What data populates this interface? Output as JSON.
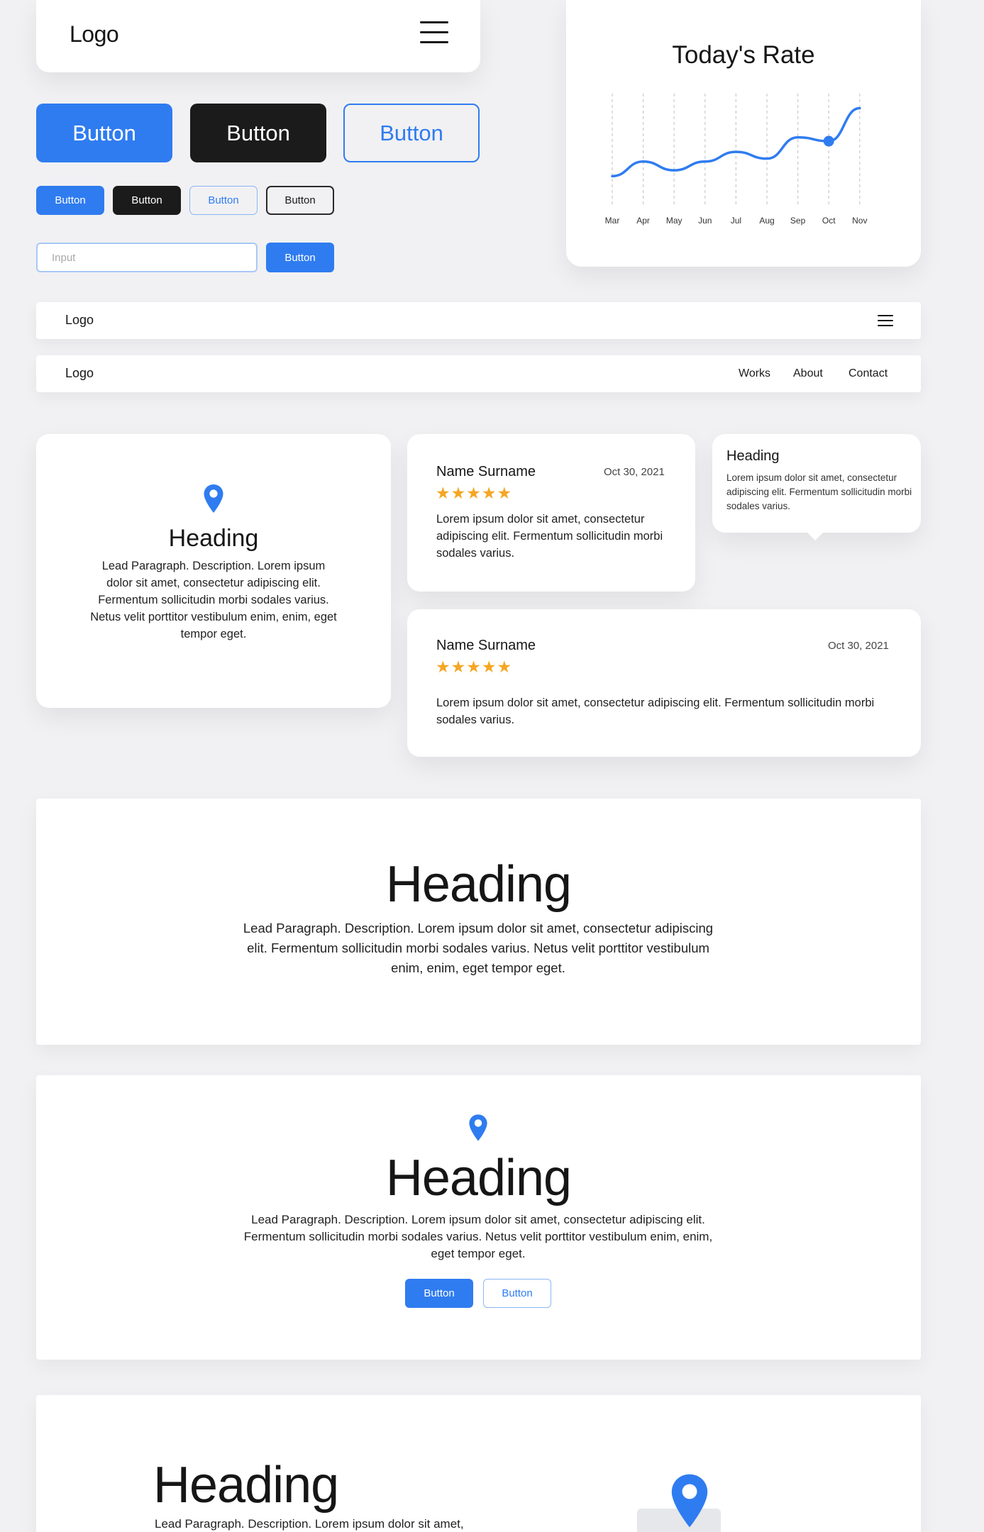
{
  "header": {
    "logo": "Logo",
    "menu_icon": "hamburger-icon"
  },
  "buttons": {
    "large": [
      "Button",
      "Button",
      "Button"
    ],
    "small": [
      "Button",
      "Button",
      "Button",
      "Button"
    ],
    "form_button": "Button"
  },
  "input": {
    "placeholder": "Input"
  },
  "chart_card": {
    "title": "Today's Rate"
  },
  "chart_data": {
    "type": "line",
    "title": "Today's Rate",
    "categories": [
      "Mar",
      "Apr",
      "May",
      "Jun",
      "Jul",
      "Aug",
      "Sep",
      "Oct",
      "Nov"
    ],
    "series": [
      {
        "values": [
          1,
          2.5,
          1.6,
          2.5,
          3.5,
          2.8,
          5,
          4.6,
          8
        ]
      }
    ],
    "highlighted_point": "Oct",
    "grid": "vertical dashed",
    "colors": {
      "line": "#2f7cf0"
    }
  },
  "nav1": {
    "logo": "Logo",
    "menu_icon": "hamburger-icon"
  },
  "nav2": {
    "logo": "Logo",
    "links": [
      "Works",
      "About",
      "Contact"
    ]
  },
  "feature_card": {
    "icon": "location-pin-icon",
    "heading": "Heading",
    "text": "Lead Paragraph. Description. Lorem ipsum dolor sit amet, consectetur adipiscing elit. Fermentum sollicitudin morbi sodales varius. Netus velit porttitor vestibulum enim, enim, eget tempor eget."
  },
  "review1": {
    "name": "Name Surname",
    "date": "Oct 30, 2021",
    "stars": "★★★★★",
    "text": "Lorem ipsum dolor sit amet, consectetur adipiscing elit. Fermentum sollicitudin morbi sodales varius."
  },
  "tooltip": {
    "heading": "Heading",
    "text": "Lorem ipsum dolor sit amet, consectetur adipiscing elit. Fermentum sollicitudin morbi sodales varius."
  },
  "review2": {
    "name": "Name Surname",
    "date": "Oct 30, 2021",
    "stars": "★★★★★",
    "text": "Lorem ipsum dolor sit amet, consectetur adipiscing elit. Fermentum sollicitudin morbi sodales varius."
  },
  "section1": {
    "heading": "Heading",
    "text": "Lead Paragraph. Description. Lorem ipsum dolor sit amet, consectetur adipiscing elit. Fermentum sollicitudin morbi sodales varius. Netus velit porttitor vestibulum enim, enim, eget tempor eget."
  },
  "section2": {
    "icon": "location-pin-icon",
    "heading": "Heading",
    "text": "Lead Paragraph. Description. Lorem ipsum dolor sit amet, consectetur adipiscing elit. Fermentum sollicitudin morbi sodales varius. Netus velit porttitor vestibulum enim, enim, eget tempor eget.",
    "primary_button": "Button",
    "secondary_button": "Button"
  },
  "section3": {
    "heading": "Heading",
    "text": "Lead Paragraph. Description. Lorem ipsum dolor sit amet,",
    "icon": "location-pin-icon"
  },
  "colors": {
    "accent": "#2f7cf0",
    "dark": "#1b1b1b",
    "star": "#f5a623",
    "background": "#f1f1f3"
  }
}
